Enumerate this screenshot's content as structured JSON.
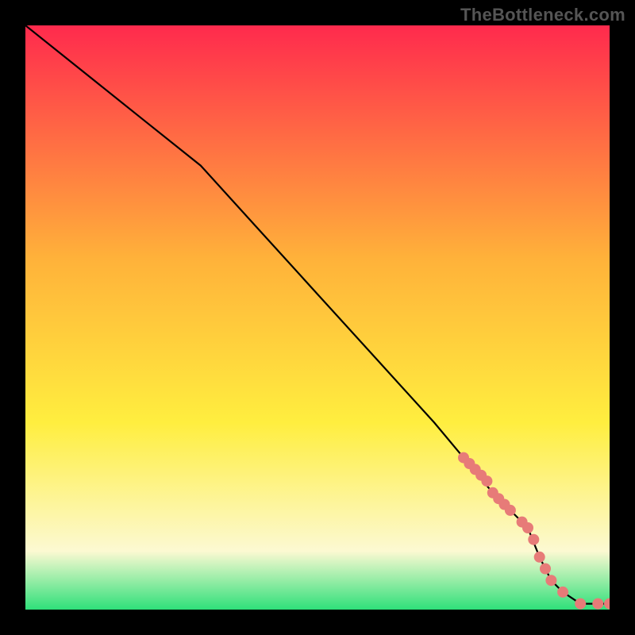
{
  "watermark": "TheBottleneck.com",
  "colors": {
    "frame": "#000000",
    "line": "#000000",
    "marker": "#e77b78",
    "gradient_top": "#ff2a4d",
    "gradient_mid1": "#ffb23a",
    "gradient_mid2": "#ffee3f",
    "gradient_mid3": "#fcf9d2",
    "gradient_bottom": "#2fe07a"
  },
  "chart_data": {
    "type": "line",
    "title": "",
    "xlabel": "",
    "ylabel": "",
    "xlim": [
      0,
      100
    ],
    "ylim": [
      0,
      100
    ],
    "series": [
      {
        "name": "curve",
        "x": [
          0,
          10,
          20,
          30,
          40,
          50,
          60,
          70,
          75,
          80,
          83,
          86,
          88,
          90,
          92,
          95,
          98,
          100
        ],
        "y": [
          100,
          92,
          84,
          76,
          65,
          54,
          43,
          32,
          26,
          20,
          17,
          14,
          9,
          5,
          3,
          1,
          1,
          1
        ]
      }
    ],
    "markers": {
      "name": "highlight-points",
      "x": [
        75,
        76,
        77,
        78,
        79,
        80,
        81,
        82,
        83,
        85,
        86,
        87,
        88,
        89,
        90,
        92,
        95,
        98,
        100
      ],
      "y": [
        26,
        25,
        24,
        23,
        22,
        20,
        19,
        18,
        17,
        15,
        14,
        12,
        9,
        7,
        5,
        3,
        1,
        1,
        1
      ]
    }
  }
}
